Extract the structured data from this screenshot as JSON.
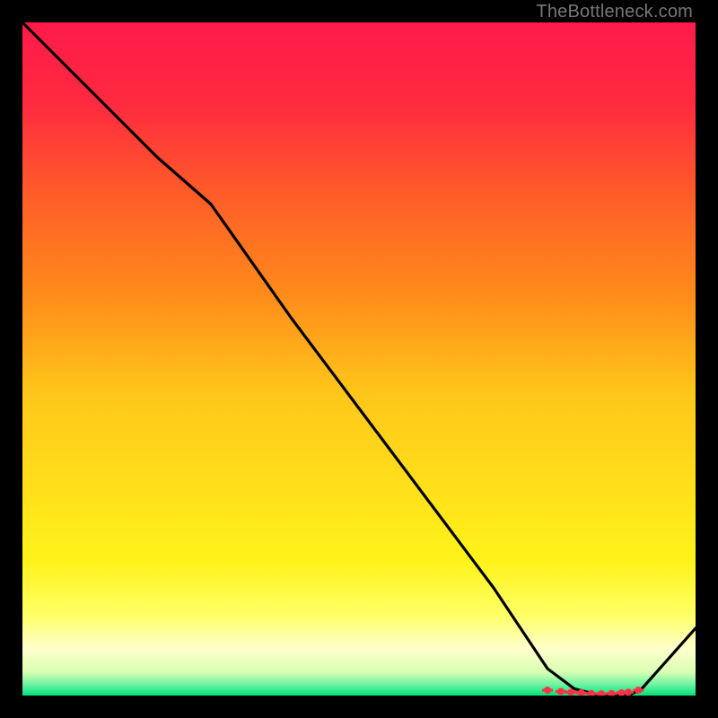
{
  "watermark": "TheBottleneck.com",
  "gradient": {
    "stops": [
      {
        "offset": 0.0,
        "color": "#ff1a4b"
      },
      {
        "offset": 0.12,
        "color": "#ff2a3f"
      },
      {
        "offset": 0.25,
        "color": "#ff5a2a"
      },
      {
        "offset": 0.4,
        "color": "#ff8a1a"
      },
      {
        "offset": 0.55,
        "color": "#ffc61a"
      },
      {
        "offset": 0.7,
        "color": "#ffe11a"
      },
      {
        "offset": 0.8,
        "color": "#fff31a"
      },
      {
        "offset": 0.88,
        "color": "#ffff66"
      },
      {
        "offset": 0.93,
        "color": "#ffffcc"
      },
      {
        "offset": 0.965,
        "color": "#d9ffb3"
      },
      {
        "offset": 0.985,
        "color": "#66f2a0"
      },
      {
        "offset": 1.0,
        "color": "#00e07a"
      }
    ]
  },
  "chart_data": {
    "type": "line",
    "title": "",
    "xlabel": "",
    "ylabel": "",
    "xlim": [
      0,
      100
    ],
    "ylim": [
      0,
      100
    ],
    "series": [
      {
        "name": "curve",
        "x": [
          0,
          10,
          20,
          28,
          40,
          55,
          70,
          78,
          82,
          86,
          90,
          92,
          100
        ],
        "y": [
          100,
          90,
          80,
          73,
          56,
          36,
          16,
          4,
          1,
          0,
          0,
          1,
          10
        ]
      }
    ],
    "markers": {
      "name": "valley-points",
      "x": [
        78,
        80,
        81.5,
        83,
        84.5,
        86,
        87.5,
        89,
        90,
        91.5
      ],
      "y": [
        0.8,
        0.6,
        0.5,
        0.4,
        0.3,
        0.25,
        0.3,
        0.4,
        0.5,
        0.8
      ],
      "color": "#ff3344",
      "radius": 4
    }
  }
}
